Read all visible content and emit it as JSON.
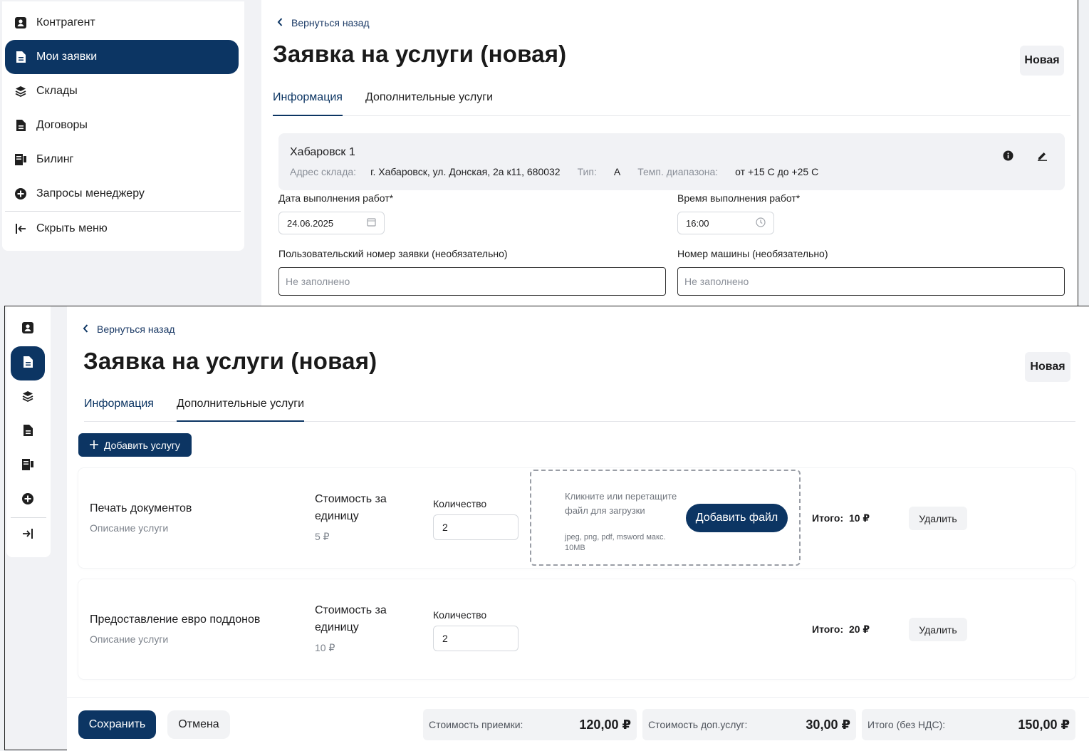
{
  "sidebar": {
    "items": [
      {
        "label": "Контрагент",
        "icon": "contact-card-icon"
      },
      {
        "label": "Мои заявки",
        "icon": "document-icon",
        "active": true
      },
      {
        "label": "Склады",
        "icon": "layers-icon"
      },
      {
        "label": "Договоры",
        "icon": "contract-icon"
      },
      {
        "label": "Билинг",
        "icon": "billing-icon"
      },
      {
        "label": "Запросы менеджеру",
        "icon": "plus-circle-icon"
      }
    ],
    "collapse_label": "Скрыть меню"
  },
  "header": {
    "back_label": "Вернуться назад",
    "title": "Заявка на услуги (новая)",
    "status": "Новая",
    "tabs": [
      "Информация",
      "Дополнительные услуги"
    ]
  },
  "info": {
    "warehouse": {
      "name": "Хабаровск 1",
      "address_label": "Адрес склада:",
      "address": "г. Хабаровск, ул. Донская, 2а к11, 680032",
      "type_label": "Тип:",
      "type": "А",
      "temp_label": "Темп. диапазона:",
      "temp": "от +15 С до +25 С"
    },
    "date_label": "Дата выполнения работ*",
    "date_value": "24.06.2025",
    "time_label": "Время выполнения работ*",
    "time_value": "16:00",
    "user_number_label": "Пользовательский номер заявки (необязательно)",
    "user_number_placeholder": "Не заполнено",
    "car_number_label": "Номер машины (необязательно)",
    "car_number_placeholder": "Не заполнено"
  },
  "services": {
    "add_label": "Добавить услугу",
    "cost_label": "Стоимость за единицу",
    "qty_label": "Количество",
    "total_label": "Итого:",
    "delete_label": "Удалить",
    "dropzone_text": "Кликните или перетащите файл для загрузки",
    "dropzone_hint": "jpeg, png, pdf, msword макс. 10MB",
    "add_file_label": "Добавить файл",
    "items": [
      {
        "name": "Печать документов",
        "desc": "Описание услуги",
        "unit_cost": "5 ₽",
        "qty": "2",
        "total": "10 ₽"
      },
      {
        "name": "Предоставление евро поддонов",
        "desc": "Описание услуги",
        "unit_cost": "10 ₽",
        "qty": "2",
        "total": "20 ₽"
      }
    ]
  },
  "footer": {
    "save_label": "Сохранить",
    "cancel_label": "Отмена",
    "summary": [
      {
        "label": "Стоимость приемки:",
        "value": "120,00 ₽"
      },
      {
        "label": "Стоимость доп.услуг:",
        "value": "30,00 ₽"
      },
      {
        "label": "Итого (без НДС):",
        "value": "150,00 ₽"
      }
    ]
  },
  "colors": {
    "primary": "#0c3563",
    "surface": "#f1f2f5"
  }
}
